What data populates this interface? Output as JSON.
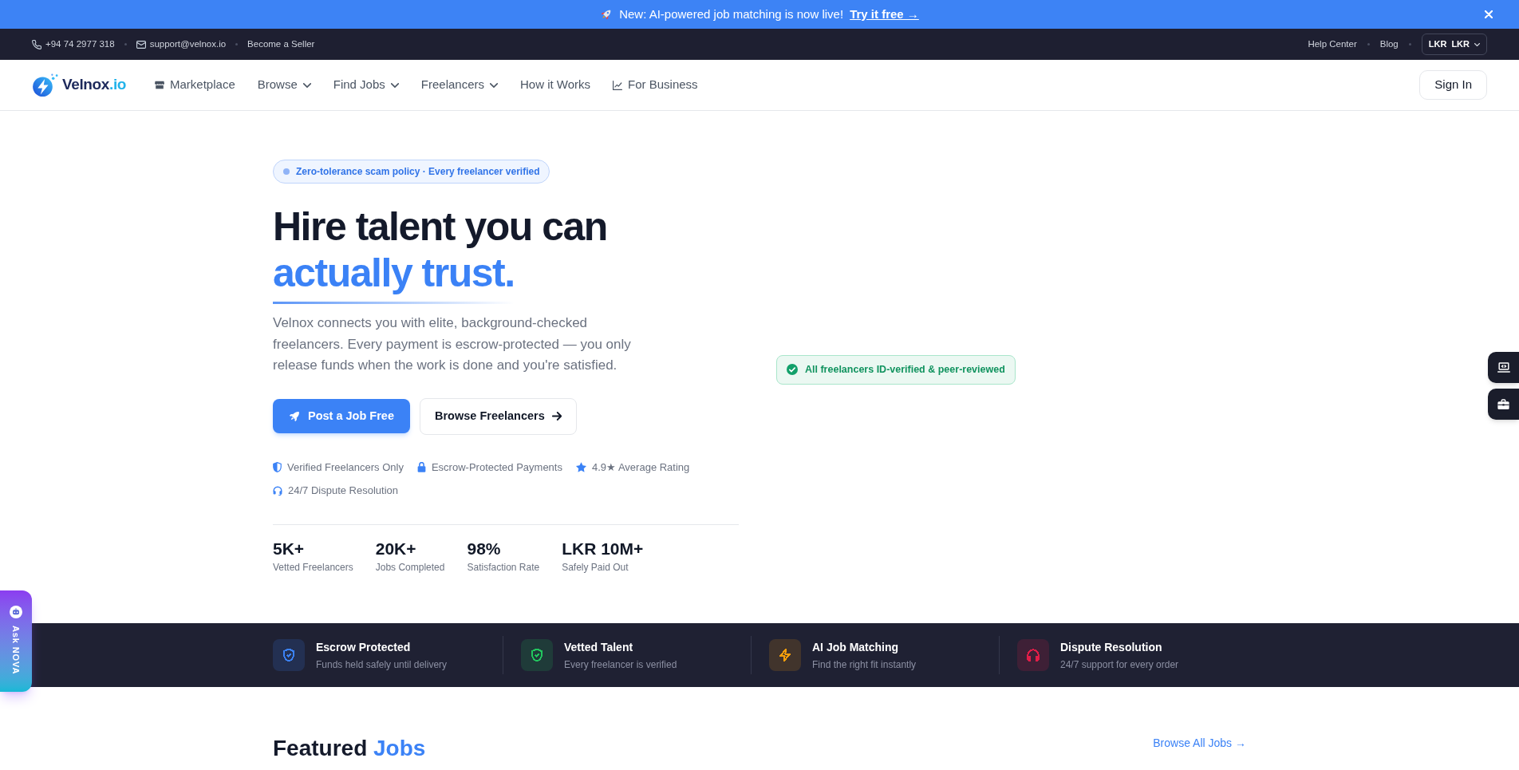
{
  "announcement": {
    "text": "New: AI-powered job matching is now live!",
    "link": "Try it free →"
  },
  "top_bar": {
    "contacts": [
      {
        "kind": "phone",
        "text": "+94 74 2977 318"
      },
      {
        "kind": "email",
        "text": "support@velnox.io"
      },
      {
        "kind": "link",
        "text": "Become a Seller"
      }
    ],
    "links": [
      "Help Center",
      "Blog"
    ],
    "currency": {
      "symbol": "LKR",
      "code": "LKR"
    }
  },
  "nav": {
    "logo": {
      "name": "Velnox",
      "suffix": ".io"
    },
    "items": [
      {
        "label": "Marketplace",
        "kind": "icon_link"
      },
      {
        "label": "Browse",
        "kind": "dropdown"
      },
      {
        "label": "Find Jobs",
        "kind": "dropdown"
      },
      {
        "label": "Freelancers",
        "kind": "dropdown"
      },
      {
        "label": "How it Works",
        "kind": "link"
      },
      {
        "label": "For Business",
        "kind": "icon_link"
      }
    ],
    "sign_in": "Sign In"
  },
  "hero": {
    "badge": "Zero-tolerance scam policy · Every freelancer verified",
    "title": "Hire talent you can",
    "title_highlight": "actually trust.",
    "description": "Velnox connects you with elite, background-checked freelancers. Every payment is escrow-protected — you only release funds when the work is done and you're satisfied.",
    "buttons": [
      {
        "label": "Post a Job Free",
        "kind": "primary"
      },
      {
        "label": "Browse Freelancers",
        "kind": "secondary"
      }
    ],
    "trust_points": [
      "Verified Freelancers Only",
      "Escrow-Protected Payments",
      "4.9★ Average Rating",
      "24/7 Dispute Resolution"
    ],
    "stats": [
      {
        "value": "5K+",
        "label": "Vetted Freelancers"
      },
      {
        "value": "20K+",
        "label": "Jobs Completed"
      },
      {
        "value": "98%",
        "label": "Satisfaction Rate"
      },
      {
        "value": "LKR 10M+",
        "label": "Safely Paid Out"
      }
    ],
    "verified_badge": "All freelancers ID-verified & peer-reviewed"
  },
  "features_band": {
    "items": [
      {
        "title": "Escrow Protected",
        "subtitle": "Funds held safely until delivery",
        "color": "#3b82f6"
      },
      {
        "title": "Vetted Talent",
        "subtitle": "Every freelancer is verified",
        "color": "#22c55e"
      },
      {
        "title": "AI Job Matching",
        "subtitle": "Find the right fit instantly",
        "color": "#f59e0b"
      },
      {
        "title": "Dispute Resolution",
        "subtitle": "24/7 support for every order",
        "color": "#e11d48"
      }
    ]
  },
  "featured_jobs": {
    "title": "Featured",
    "title_highlight": "Jobs",
    "link": "Browse All Jobs →"
  },
  "assistant_tab": {
    "label": "Ask NOVA"
  }
}
